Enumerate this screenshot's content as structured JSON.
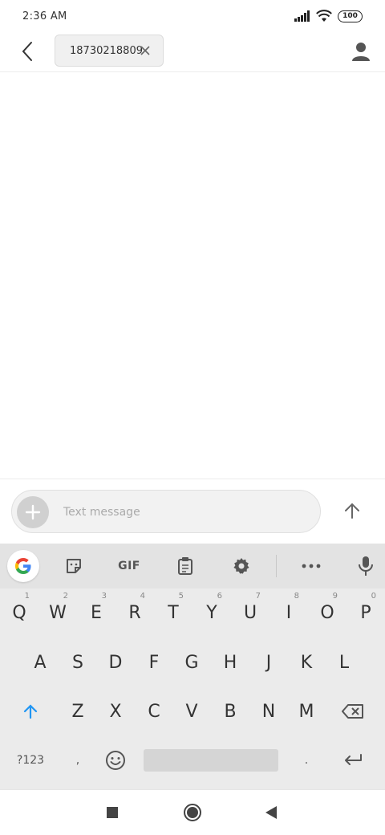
{
  "status_bar": {
    "time": "2:36 AM",
    "battery": "100"
  },
  "header": {
    "recipient": "18730218809"
  },
  "compose": {
    "placeholder": "Text message"
  },
  "keyboard": {
    "toolbar": {
      "gif": "GIF"
    },
    "row1": [
      {
        "key": "Q",
        "hint": "1"
      },
      {
        "key": "W",
        "hint": "2"
      },
      {
        "key": "E",
        "hint": "3"
      },
      {
        "key": "R",
        "hint": "4"
      },
      {
        "key": "T",
        "hint": "5"
      },
      {
        "key": "Y",
        "hint": "6"
      },
      {
        "key": "U",
        "hint": "7"
      },
      {
        "key": "I",
        "hint": "8"
      },
      {
        "key": "O",
        "hint": "9"
      },
      {
        "key": "P",
        "hint": "0"
      }
    ],
    "row2": [
      "A",
      "S",
      "D",
      "F",
      "G",
      "H",
      "J",
      "K",
      "L"
    ],
    "row3": [
      "Z",
      "X",
      "C",
      "V",
      "B",
      "N",
      "M"
    ],
    "row4": {
      "symbols": "?123",
      "comma": ",",
      "period": "."
    }
  },
  "colors": {
    "accent": "#2196F3",
    "keyboard_bg": "#EBEBEB"
  },
  "icons": {
    "back": "chevron-left-icon",
    "close": "close-icon",
    "contact": "person-icon",
    "add": "plus-icon",
    "send": "arrow-up-icon",
    "shift": "shift-icon",
    "backspace": "backspace-icon",
    "enter": "enter-icon",
    "emoji": "emoji-icon",
    "mic": "mic-icon",
    "settings": "gear-icon",
    "clipboard": "clipboard-icon",
    "sticker": "sticker-icon",
    "more": "more-icon",
    "google": "google-icon"
  }
}
